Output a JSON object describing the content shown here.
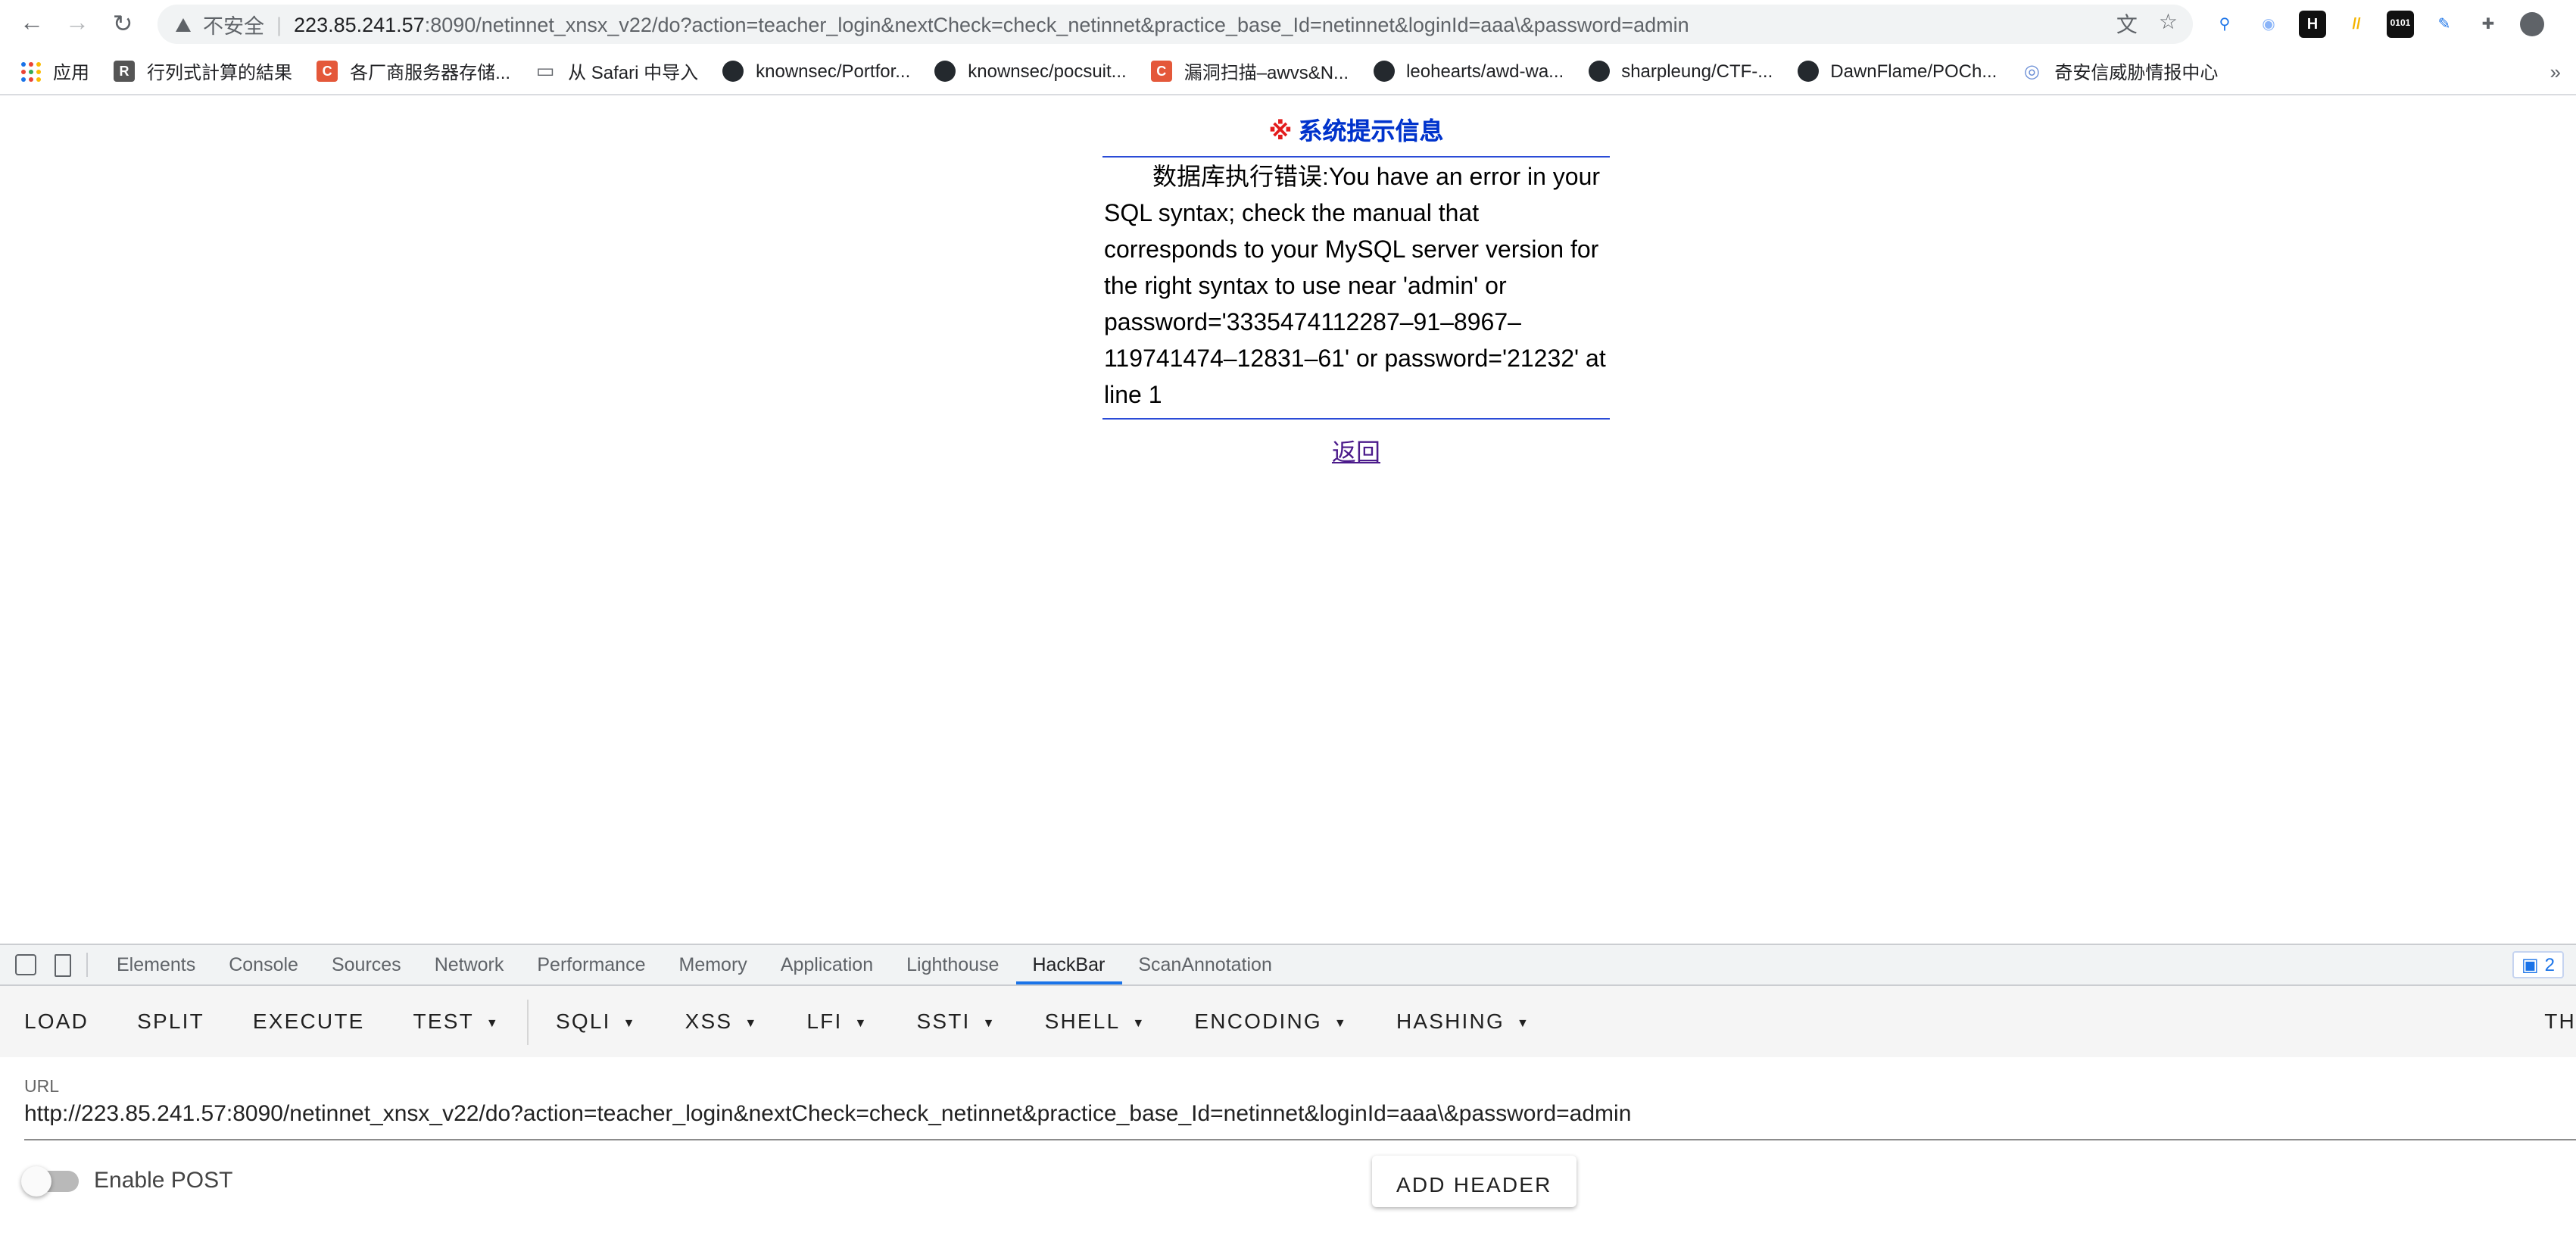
{
  "browser": {
    "insecure_label": "不安全",
    "url_host": "223.85.241.57",
    "url_rest": ":8090/netinnet_xnsx_v22/do?action=teacher_login&nextCheck=check_netinnet&practice_base_Id=netinnet&loginId=aaa\\&password=admin",
    "extensions": [
      {
        "icon": "pin-icon",
        "glyph": "⚲",
        "color": "#1a73e8"
      },
      {
        "icon": "circle-ext-icon",
        "glyph": "◉",
        "color": "#8ab4f8"
      },
      {
        "icon": "h-ext-icon",
        "glyph": "H",
        "color": "#ffffff",
        "bg": "#111111"
      },
      {
        "icon": "slash-ext-icon",
        "glyph": "//",
        "color": "#f4b400"
      },
      {
        "icon": "binary-ext-icon",
        "glyph": "0101",
        "color": "#ffffff",
        "bg": "#111111"
      },
      {
        "icon": "pen-ext-icon",
        "glyph": "✎",
        "color": "#1a73e8"
      },
      {
        "icon": "puzzle-icon",
        "glyph": "✚",
        "color": "#5f6368"
      }
    ]
  },
  "bookmarks": {
    "apps_label": "应用",
    "items": [
      {
        "label": "行列式計算的結果",
        "icon": "rr"
      },
      {
        "label": "各厂商服务器存储...",
        "icon": "csdn"
      },
      {
        "label": "从 Safari 中导入",
        "icon": "folder"
      },
      {
        "label": "knownsec/Portfor...",
        "icon": "gh"
      },
      {
        "label": "knownsec/pocsuit...",
        "icon": "gh"
      },
      {
        "label": "漏洞扫描–awvs&N...",
        "icon": "csdn"
      },
      {
        "label": "leohearts/awd-wa...",
        "icon": "gh"
      },
      {
        "label": "sharpleung/CTF-...",
        "icon": "gh"
      },
      {
        "label": "DawnFlame/POCh...",
        "icon": "gh"
      },
      {
        "label": "奇安信威胁情报中心",
        "icon": "eye"
      }
    ],
    "more": "»"
  },
  "page": {
    "title_mark": "※",
    "title": "系统提示信息",
    "message": "数据库执行错误:You have an error in your SQL syntax; check the manual that corresponds to your MySQL server version for the right syntax to use near 'admin' or password='3335474112287–91–8967–119741474–12831–61' or password='21232' at line 1",
    "back_link": "返回"
  },
  "devtools": {
    "tabs": [
      "Elements",
      "Console",
      "Sources",
      "Network",
      "Performance",
      "Memory",
      "Application",
      "Lighthouse",
      "HackBar",
      "ScanAnnotation"
    ],
    "active_tab": "HackBar",
    "badge_count": "2"
  },
  "hackbar": {
    "buttons": [
      {
        "label": "LOAD",
        "caret": false
      },
      {
        "label": "SPLIT",
        "caret": false
      },
      {
        "label": "EXECUTE",
        "caret": false
      },
      {
        "label": "TEST",
        "caret": true
      },
      {
        "label": "SQLI",
        "caret": true
      },
      {
        "label": "XSS",
        "caret": true
      },
      {
        "label": "LFI",
        "caret": true
      },
      {
        "label": "SSTI",
        "caret": true
      },
      {
        "label": "SHELL",
        "caret": true
      },
      {
        "label": "ENCODING",
        "caret": true
      },
      {
        "label": "HASHING",
        "caret": true
      }
    ],
    "overflow_label": "TH",
    "url_label": "URL",
    "url_value": "http://223.85.241.57:8090/netinnet_xnsx_v22/do?action=teacher_login&nextCheck=check_netinnet&practice_base_Id=netinnet&loginId=aaa\\&password=admin",
    "enable_post_label": "Enable POST",
    "enable_post": false,
    "add_header_label": "ADD HEADER"
  }
}
